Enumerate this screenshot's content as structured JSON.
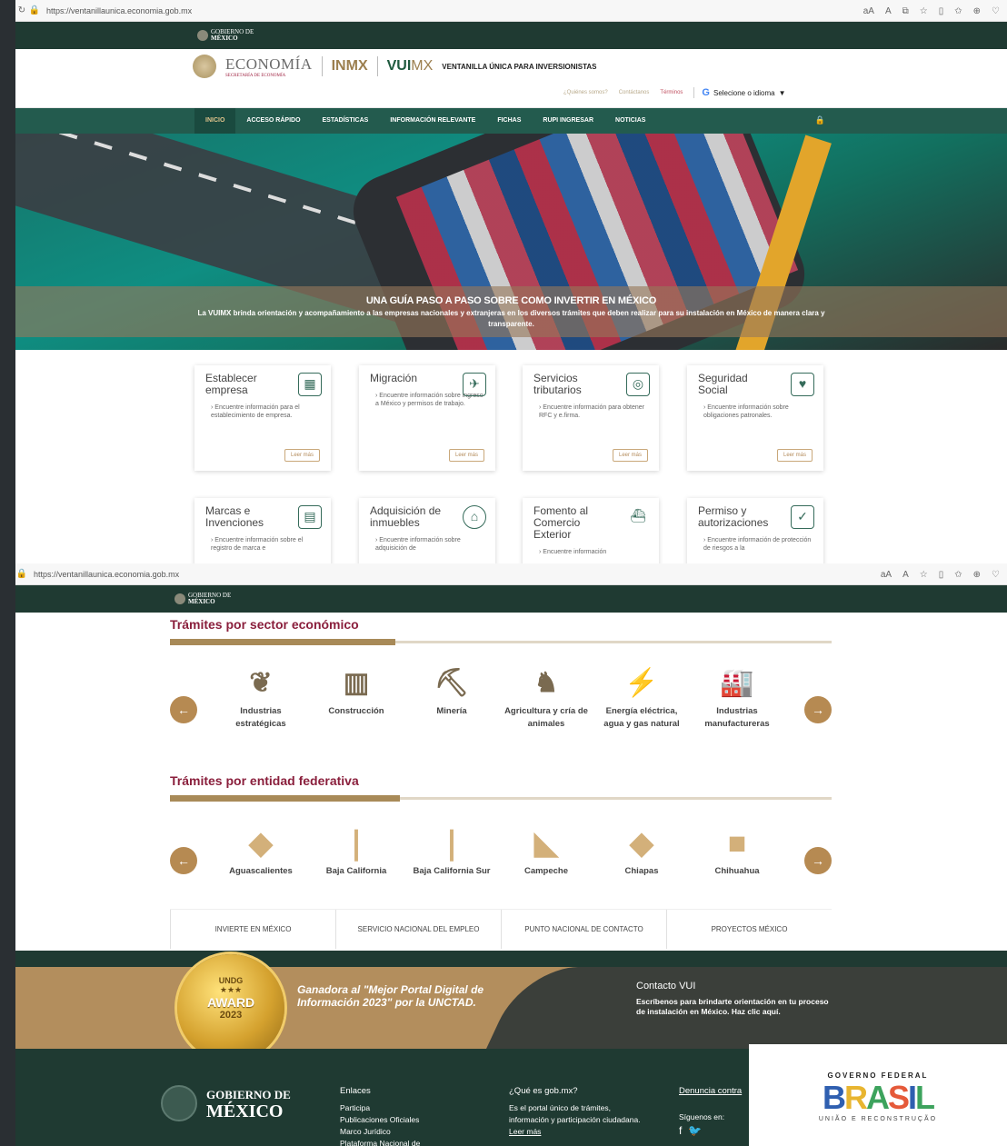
{
  "browser1": {
    "url": "https://ventanillaunica.economia.gob.mx"
  },
  "browser2": {
    "url": "https://ventanillaunica.economia.gob.mx"
  },
  "gob_bar": {
    "line1": "GOBIERNO DE",
    "line2": "MÉXICO"
  },
  "header": {
    "economia": "ECONOMÍA",
    "economia_sub": "SECRETARÍA DE ECONOMÍA",
    "inmx": "INMX",
    "vuimx_a": "VUI",
    "vuimx_b": "MX",
    "ventanilla": "VENTANILLA ÚNICA PARA INVERSIONISTAS",
    "links": {
      "quienes": "¿Quiénes somos?",
      "contactanos": "Contáctanos",
      "terminos": "Términos"
    },
    "language": "Selecione o idioma"
  },
  "nav": {
    "items": [
      "INICIO",
      "ACCESO RÁPIDO",
      "ESTADÍSTICAS",
      "INFORMACIÓN RELEVANTE",
      "FICHAS",
      "RUPI INGRESAR",
      "NOTICIAS"
    ]
  },
  "hero": {
    "title": "UNA GUÍA PASO A PASO SOBRE COMO INVERTIR EN MÉXICO",
    "text": "La VUIMX brinda orientación y acompañamiento a las empresas nacionales y extranjeras en los diversos trámites que deben realizar para su instalación en México de manera clara y transparente."
  },
  "cards": [
    {
      "title": "Establecer empresa",
      "text": "Encuentre información para el establecimiento de empresa.",
      "button": "Leer más",
      "icon": "building-docs-icon"
    },
    {
      "title": "Migración",
      "text": "Encuentre información sobre ingreso a México y permisos de trabajo.",
      "button": "Leer más",
      "icon": "bird-icon"
    },
    {
      "title": "Servicios tributarios",
      "text": "Encuentre información para obtener RFC y e.firma.",
      "button": "Leer más",
      "icon": "coins-icon"
    },
    {
      "title": "Seguridad Social",
      "text": "Encuentre información sobre obligaciones patronales.",
      "button": "Leer más",
      "icon": "hands-icon"
    },
    {
      "title": "Marcas e Invenciones",
      "text": "Encuentre información sobre el registro de marca e",
      "icon": "certificate-icon"
    },
    {
      "title": "Adquisición de inmuebles",
      "text": "Encuentre información sobre adquisición de",
      "icon": "house-search-icon"
    },
    {
      "title": "Fomento al Comercio Exterior",
      "text": "Encuentre información",
      "icon": "ship-icon"
    },
    {
      "title": "Permiso y autorizaciones",
      "text": "Encuentre información de protección de riesgos a la",
      "icon": "check-doc-icon"
    }
  ],
  "sector": {
    "title": "Trámites por sector económico",
    "items": [
      {
        "label": "Industrias estratégicas",
        "icon": "map-icon"
      },
      {
        "label": "Construcción",
        "icon": "building-icon"
      },
      {
        "label": "Minería",
        "icon": "mine-cart-icon"
      },
      {
        "label": "Agricultura y cría de animales",
        "icon": "cow-icon"
      },
      {
        "label": "Energía eléctrica, agua y gas natural",
        "icon": "energy-icon"
      },
      {
        "label": "Industrias manufactureras",
        "icon": "factory-icon"
      }
    ]
  },
  "entidad": {
    "title": "Trámites por entidad federativa",
    "items": [
      "Aguascalientes",
      "Baja California",
      "Baja California Sur",
      "Campeche",
      "Chiapas",
      "Chihuahua"
    ]
  },
  "bottom_links": [
    "INVIERTE EN MÉXICO",
    "SERVICIO NACIONAL DEL EMPLEO",
    "PUNTO NACIONAL DE CONTACTO",
    "PROYECTOS MÉXICO"
  ],
  "award": {
    "m1": "UNDG",
    "m2": "★★★",
    "m3": "AWARD",
    "m4": "2023",
    "quote": "Ganadora al \"Mejor Portal Digital de Información 2023\" por la UNCTAD."
  },
  "contact": {
    "title": "Contacto VUI",
    "text": "Escríbenos para brindarte orientación en tu proceso de instalación en México. Haz clic aquí."
  },
  "footer": {
    "gob1": "GOBIERNO DE",
    "gob2": "MÉXICO",
    "enlaces_title": "Enlaces",
    "enlaces": [
      "Participa",
      "Publicaciones Oficiales",
      "Marco Jurídico",
      "Plataforma Nacional de"
    ],
    "que_title": "¿Qué es gob.mx?",
    "que_text": "Es el portal único de trámites, información y participación ciudadana.",
    "leer_mas": "Leer más",
    "denuncia": "Denuncia contra",
    "siguenos": "Síguenos en:"
  },
  "brasil": {
    "top": "GOVERNO FEDERAL",
    "word": [
      "B",
      "R",
      "A",
      "S",
      "I",
      "L"
    ],
    "bottom": "UNIÃO E RECONSTRUÇÃO"
  }
}
